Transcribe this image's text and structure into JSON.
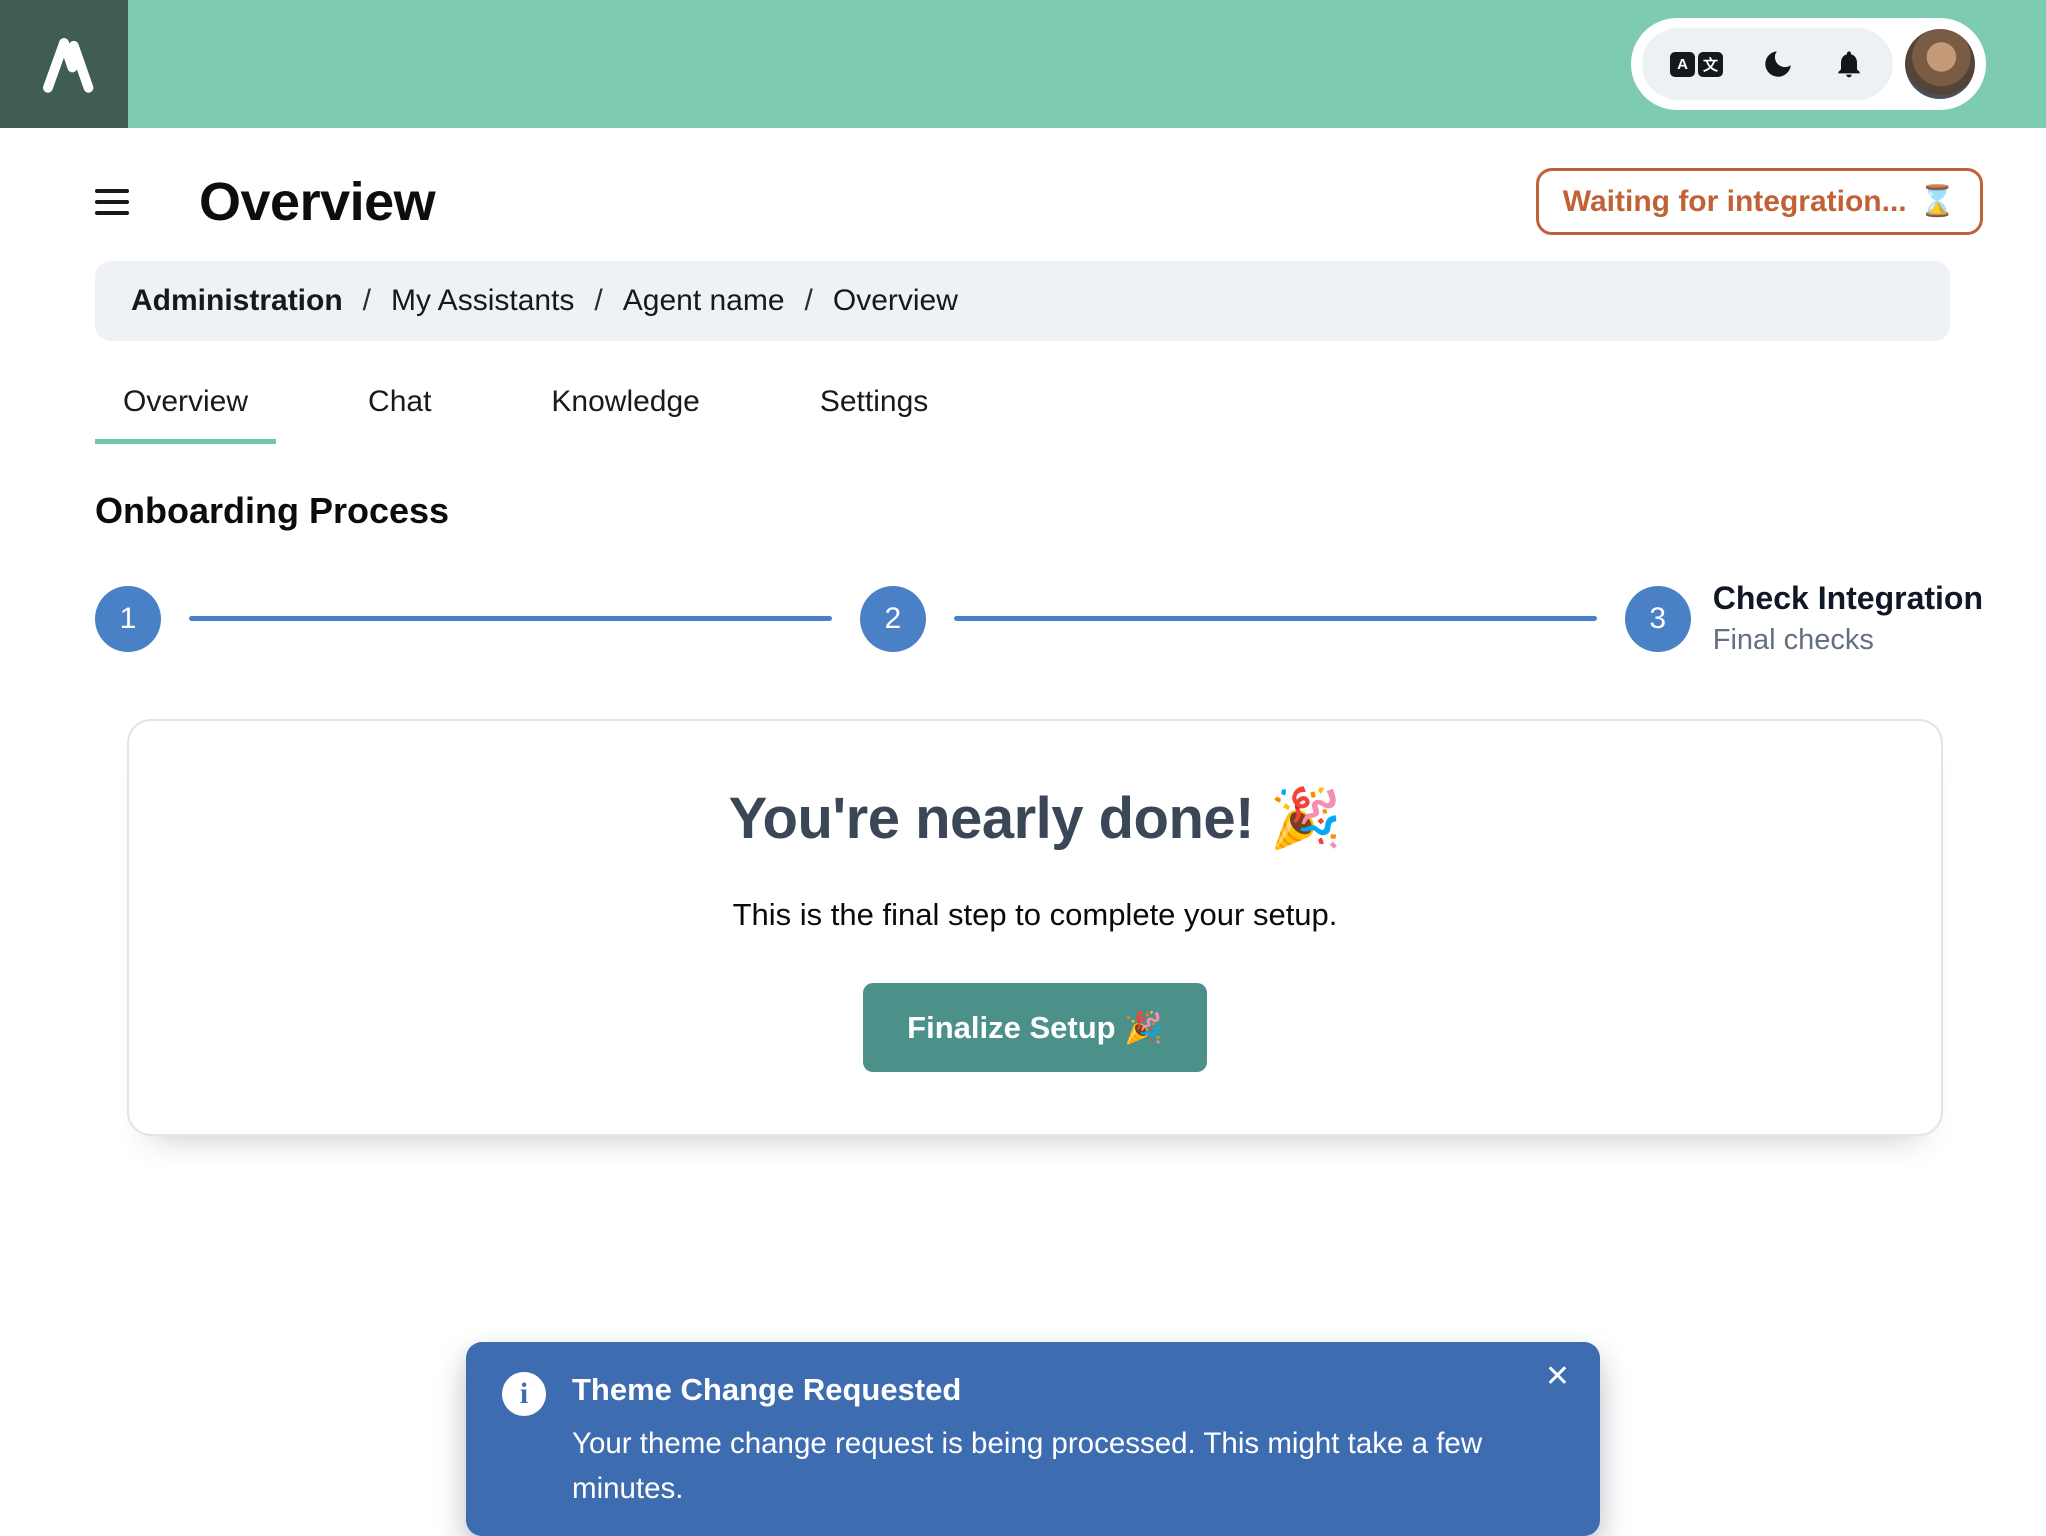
{
  "colors": {
    "header_green": "#7dccb2",
    "logo_bg": "#3f5e51",
    "badge_orange": "#bf6236",
    "stepper_blue": "#4a80c6",
    "toast_blue": "#3e6cb0",
    "button_teal": "#4b9189",
    "tab_underline_green": "#6fc7a4"
  },
  "header": {
    "translate_icon": {
      "left_glyph": "A",
      "right_glyph": "文"
    }
  },
  "page": {
    "title": "Overview",
    "status_badge": {
      "label": "Waiting for integration...",
      "icon": "⌛"
    },
    "breadcrumb": {
      "separator": "/",
      "items": [
        "Administration",
        "My Assistants",
        "Agent name",
        "Overview"
      ]
    },
    "tabs": [
      {
        "label": "Overview",
        "active": true
      },
      {
        "label": "Chat",
        "active": false
      },
      {
        "label": "Knowledge",
        "active": false
      },
      {
        "label": "Settings",
        "active": false
      }
    ],
    "section_title": "Onboarding Process",
    "stepper": {
      "steps": [
        {
          "number": "1"
        },
        {
          "number": "2"
        },
        {
          "number": "3",
          "title": "Check Integration",
          "subtitle": "Final checks"
        }
      ]
    },
    "card": {
      "heading": "You're nearly done! 🎉",
      "subtext": "This is the final step to complete your setup.",
      "button_label": "Finalize Setup 🎉"
    },
    "toast": {
      "info_glyph": "i",
      "title": "Theme Change Requested",
      "body": "Your theme change request is being processed. This might take a few minutes.",
      "close_glyph": "✕"
    }
  }
}
